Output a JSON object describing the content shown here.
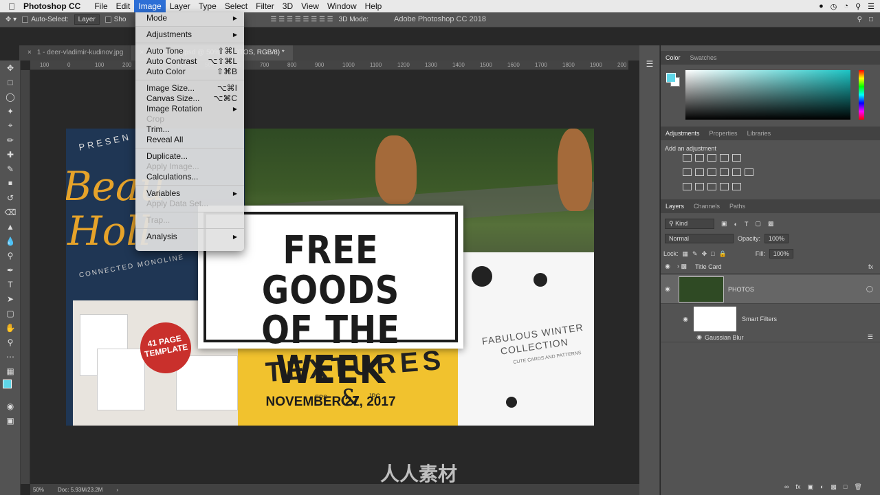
{
  "menubar": {
    "app_name": "Photoshop CC",
    "items": [
      "File",
      "Edit",
      "Image",
      "Layer",
      "Type",
      "Select",
      "Filter",
      "3D",
      "View",
      "Window",
      "Help"
    ],
    "active": "Image"
  },
  "options_bar": {
    "auto_select_label": "Auto-Select:",
    "auto_select_value": "Layer",
    "show_label": "Sho",
    "mode_3d_label": "3D Mode:"
  },
  "app_title": "Adobe Photoshop CC 2018",
  "doc_tabs": [
    {
      "label": "1 - deer-vladimir-kudinov.jpg",
      "active": false
    },
    {
      "label": "2 - Nesting.psd @ 50% (PHOTOS, RGB/8) *",
      "active": true
    }
  ],
  "ruler_ticks": [
    "100",
    "0",
    "100",
    "200",
    "300",
    "400",
    "500",
    "600",
    "700",
    "800",
    "900",
    "1000",
    "1100",
    "1200",
    "1300",
    "1400",
    "1500",
    "1600",
    "1700",
    "1800",
    "1900",
    "200"
  ],
  "image_menu": [
    {
      "label": "Mode",
      "shortcut": "",
      "submenu": true,
      "disabled": false
    },
    {
      "sep": true
    },
    {
      "label": "Adjustments",
      "shortcut": "",
      "submenu": true,
      "disabled": false
    },
    {
      "sep": true
    },
    {
      "label": "Auto Tone",
      "shortcut": "⇧⌘L",
      "submenu": false,
      "disabled": false
    },
    {
      "label": "Auto Contrast",
      "shortcut": "⌥⇧⌘L",
      "submenu": false,
      "disabled": false
    },
    {
      "label": "Auto Color",
      "shortcut": "⇧⌘B",
      "submenu": false,
      "disabled": false
    },
    {
      "sep": true
    },
    {
      "label": "Image Size...",
      "shortcut": "⌥⌘I",
      "submenu": false,
      "disabled": false
    },
    {
      "label": "Canvas Size...",
      "shortcut": "⌥⌘C",
      "submenu": false,
      "disabled": false
    },
    {
      "label": "Image Rotation",
      "shortcut": "",
      "submenu": true,
      "disabled": false
    },
    {
      "label": "Crop",
      "shortcut": "",
      "submenu": false,
      "disabled": true
    },
    {
      "label": "Trim...",
      "shortcut": "",
      "submenu": false,
      "disabled": false
    },
    {
      "label": "Reveal All",
      "shortcut": "",
      "submenu": false,
      "disabled": false
    },
    {
      "sep": true
    },
    {
      "label": "Duplicate...",
      "shortcut": "",
      "submenu": false,
      "disabled": false
    },
    {
      "label": "Apply Image...",
      "shortcut": "",
      "submenu": false,
      "disabled": true
    },
    {
      "label": "Calculations...",
      "shortcut": "",
      "submenu": false,
      "disabled": false
    },
    {
      "sep": true
    },
    {
      "label": "Variables",
      "shortcut": "",
      "submenu": true,
      "disabled": false
    },
    {
      "label": "Apply Data Set...",
      "shortcut": "",
      "submenu": false,
      "disabled": true
    },
    {
      "sep": true
    },
    {
      "label": "Trap...",
      "shortcut": "",
      "submenu": false,
      "disabled": true
    },
    {
      "sep": true
    },
    {
      "label": "Analysis",
      "shortcut": "",
      "submenu": true,
      "disabled": false
    }
  ],
  "canvas": {
    "title_line1": "FREE GOODS",
    "title_line2": "OF THE WEEK",
    "date": "NOVEMBER 27, 2017",
    "left_book_presents": "PRESEN",
    "left_book_script1": "Beau",
    "left_book_script2": "Holl",
    "left_book_monoline": "CONNECTED MONOLINE",
    "badge": "41 PAGE TEMPLATE",
    "textures_title": "TEXTURES",
    "textures_amp": "&",
    "textures_eps": "EPS",
    "textures_jpg": "JPG",
    "winter_title": "FABULOUS WINTER COLLECTION",
    "winter_sub": "CUTE CARDS AND PATTERNS"
  },
  "panels": {
    "color_tabs": [
      "Color",
      "Swatches"
    ],
    "adjust_tabs": [
      "Adjustments",
      "Properties",
      "Libraries"
    ],
    "add_adjustment": "Add an adjustment",
    "layer_tabs": [
      "Layers",
      "Channels",
      "Paths"
    ],
    "kind_label": "Kind",
    "blend_mode": "Normal",
    "opacity_label": "Opacity:",
    "opacity_value": "100%",
    "lock_label": "Lock:",
    "fill_label": "Fill:",
    "fill_value": "100%",
    "layers": [
      {
        "name": "Title Card",
        "type": "group"
      },
      {
        "name": "PHOTOS",
        "type": "smart"
      },
      {
        "name": "Smart Filters",
        "type": "filters"
      },
      {
        "name": "Gaussian Blur",
        "type": "filter"
      }
    ]
  },
  "status": {
    "zoom": "50%",
    "doc_size": "Doc: 5.93M/23.2M"
  },
  "watermark": "人人素材",
  "colors": {
    "foreground": "#5ed6e8",
    "menu_highlight": "#2d6fd6"
  }
}
